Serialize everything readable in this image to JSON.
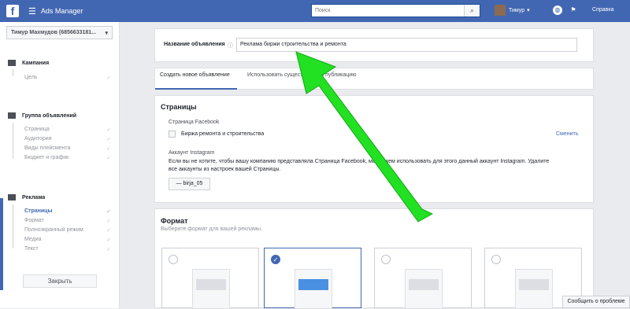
{
  "topbar": {
    "app_title": "Ads Manager",
    "search_placeholder": "Поиск",
    "user_name": "Тимур",
    "help": "Справка"
  },
  "sidebar": {
    "account": "Тимур Махмудов (6856633181...",
    "campaign": {
      "title": "Кампания",
      "items": [
        "Цель"
      ]
    },
    "adset": {
      "title": "Группа объявлений",
      "items": [
        "Страница",
        "Аудитория",
        "Виды плейсмента",
        "Бюджет и график"
      ]
    },
    "ad": {
      "title": "Реклама",
      "items": [
        "Страницы",
        "Формат",
        "Полноэкранный режим",
        "Медиа",
        "Текст"
      ]
    },
    "close_button": "Закрыть"
  },
  "main": {
    "ad_name_label": "Название объявления",
    "ad_name_value": "Реклама биржи строительства и ремонта",
    "tabs": [
      "Создать новое объявление",
      "Использовать существующую публикацию"
    ],
    "pages": {
      "title": "Страницы",
      "facebook_label": "Страница Facebook",
      "facebook_page": "Биржа ремонта и строительства",
      "change": "Сменить",
      "instagram_label": "Аккаунт Instagram",
      "instagram_text": "Если вы не хотите, чтобы вашу компанию представляла Страница Facebook, мы можем использовать для этого данный аккаунт Instagram. Удалите все аккаунты из настроек вашей Страницы.",
      "instagram_account": "birja_05"
    },
    "format": {
      "title": "Формат",
      "subtitle": "Выберите формат для вашей рекламы."
    }
  },
  "report_problem": "Сообщить о проблеме",
  "colors": {
    "brand": "#4267b2",
    "arrow": "#22e022"
  }
}
